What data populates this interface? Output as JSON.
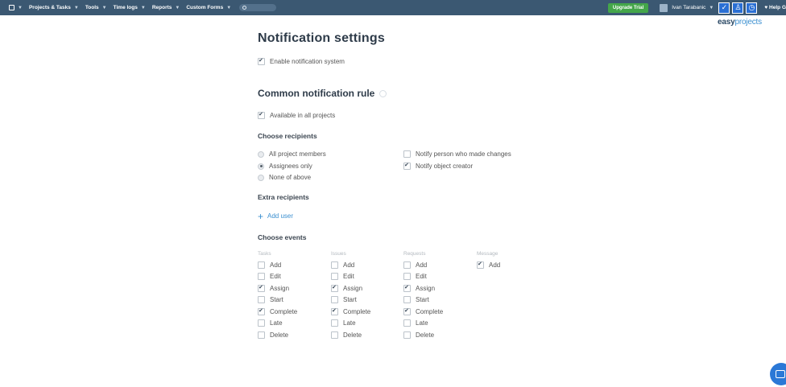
{
  "topbar": {
    "nav": [
      {
        "label": "Projects & Tasks"
      },
      {
        "label": "Tools"
      },
      {
        "label": "Time logs"
      },
      {
        "label": "Reports"
      },
      {
        "label": "Custom Forms"
      }
    ],
    "upgrade_label": "Upgrade Trial",
    "user_name": "Ivan Tarabanic",
    "help_label": "Help G",
    "brand_left": "easy",
    "brand_right": "projects"
  },
  "page": {
    "title": "Notification settings",
    "enable_label": "Enable notification system",
    "common_title": "Common notification rule",
    "available_label": "Available in all projects",
    "choose_recipients": "Choose recipients",
    "radios": [
      {
        "label": "All project members",
        "checked": false
      },
      {
        "label": "Assignees only",
        "checked": true
      },
      {
        "label": "None of above",
        "checked": false
      }
    ],
    "notify_person": "Notify person who made changes",
    "notify_creator": "Notify object creator",
    "extra_recipients": "Extra recipients",
    "add_user": "Add user",
    "choose_events": "Choose events"
  },
  "events": {
    "columns": [
      "Tasks",
      "Issues",
      "Requests",
      "Message"
    ],
    "labels": [
      "Add",
      "Edit",
      "Assign",
      "Start",
      "Complete",
      "Late",
      "Delete"
    ],
    "message_add": "Add"
  }
}
